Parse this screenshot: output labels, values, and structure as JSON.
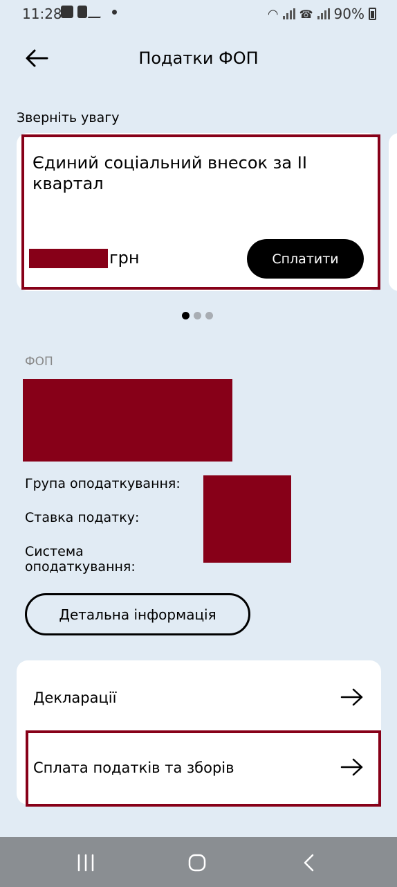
{
  "status_bar": {
    "time": "11:28",
    "battery": "90%"
  },
  "header": {
    "title": "Податки ФОП"
  },
  "attention": {
    "heading": "Зверніть увагу",
    "card": {
      "title": "Єдиний соціальний внесок за II квартал",
      "amount_unit": "грн",
      "pay_label": "Сплатити"
    },
    "pager": {
      "count": 3,
      "active": 0
    }
  },
  "fop": {
    "section_label": "ФОП",
    "group_label": "Група оподаткування:",
    "rate_label": "Ставка податку:",
    "system_label_line1": "Система",
    "system_label_line2": "оподаткування:",
    "details_label": "Детальна інформація"
  },
  "links": [
    {
      "label": "Декларації"
    },
    {
      "label": "Сплата податків та зборів"
    }
  ],
  "colors": {
    "background": "#e1ebf4",
    "redaction": "#870018",
    "card": "#ffffff"
  }
}
